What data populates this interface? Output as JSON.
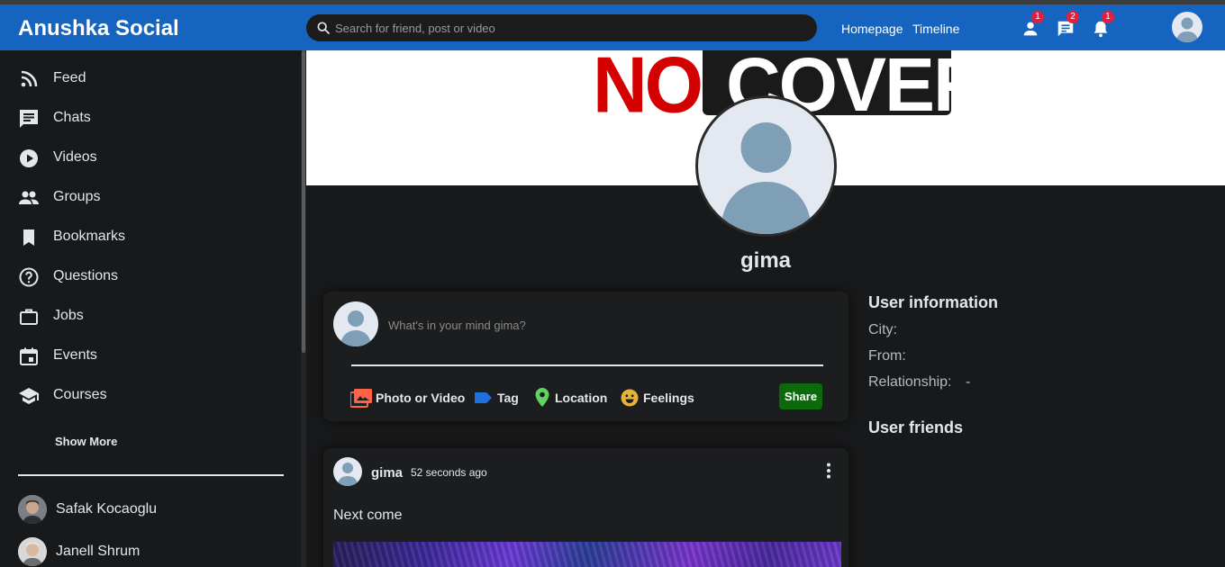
{
  "app": {
    "title": "Anushka Social"
  },
  "search": {
    "placeholder": "Search for friend, post or video"
  },
  "topbar": {
    "links": [
      "Homepage",
      "Timeline"
    ],
    "badges": {
      "friends": "1",
      "messages": "2",
      "notifications": "1"
    },
    "icons": [
      "person-icon",
      "chat-icon",
      "bell-icon"
    ]
  },
  "sidebar": {
    "items": [
      {
        "label": "Feed",
        "icon": "rss-icon"
      },
      {
        "label": "Chats",
        "icon": "chat-icon"
      },
      {
        "label": "Videos",
        "icon": "play-circle-icon"
      },
      {
        "label": "Groups",
        "icon": "group-icon"
      },
      {
        "label": "Bookmarks",
        "icon": "bookmark-icon"
      },
      {
        "label": "Questions",
        "icon": "help-circle-icon"
      },
      {
        "label": "Jobs",
        "icon": "briefcase-icon"
      },
      {
        "label": "Events",
        "icon": "calendar-icon"
      },
      {
        "label": "Courses",
        "icon": "school-icon"
      }
    ],
    "show_more": "Show More",
    "friends": [
      {
        "name": "Safak Kocaoglu"
      },
      {
        "name": "Janell Shrum"
      }
    ]
  },
  "profile": {
    "cover_text_1": "NO",
    "cover_text_2": "COVER",
    "username": "gima"
  },
  "share": {
    "placeholder": "What's in your mind gima?",
    "options": [
      "Photo or Video",
      "Tag",
      "Location",
      "Feelings"
    ],
    "button": "Share"
  },
  "post": {
    "author": "gima",
    "time": "52 seconds ago",
    "text": "Next come"
  },
  "user_info": {
    "title": "User information",
    "fields": [
      {
        "label": "City:",
        "value": ""
      },
      {
        "label": "From:",
        "value": ""
      },
      {
        "label": "Relationship:",
        "value": "-"
      }
    ],
    "friends_title": "User friends"
  },
  "colors": {
    "accent": "#1565c0",
    "background": "#18191a",
    "share_button": "#0b6b0b",
    "badge": "#e41e3f"
  }
}
